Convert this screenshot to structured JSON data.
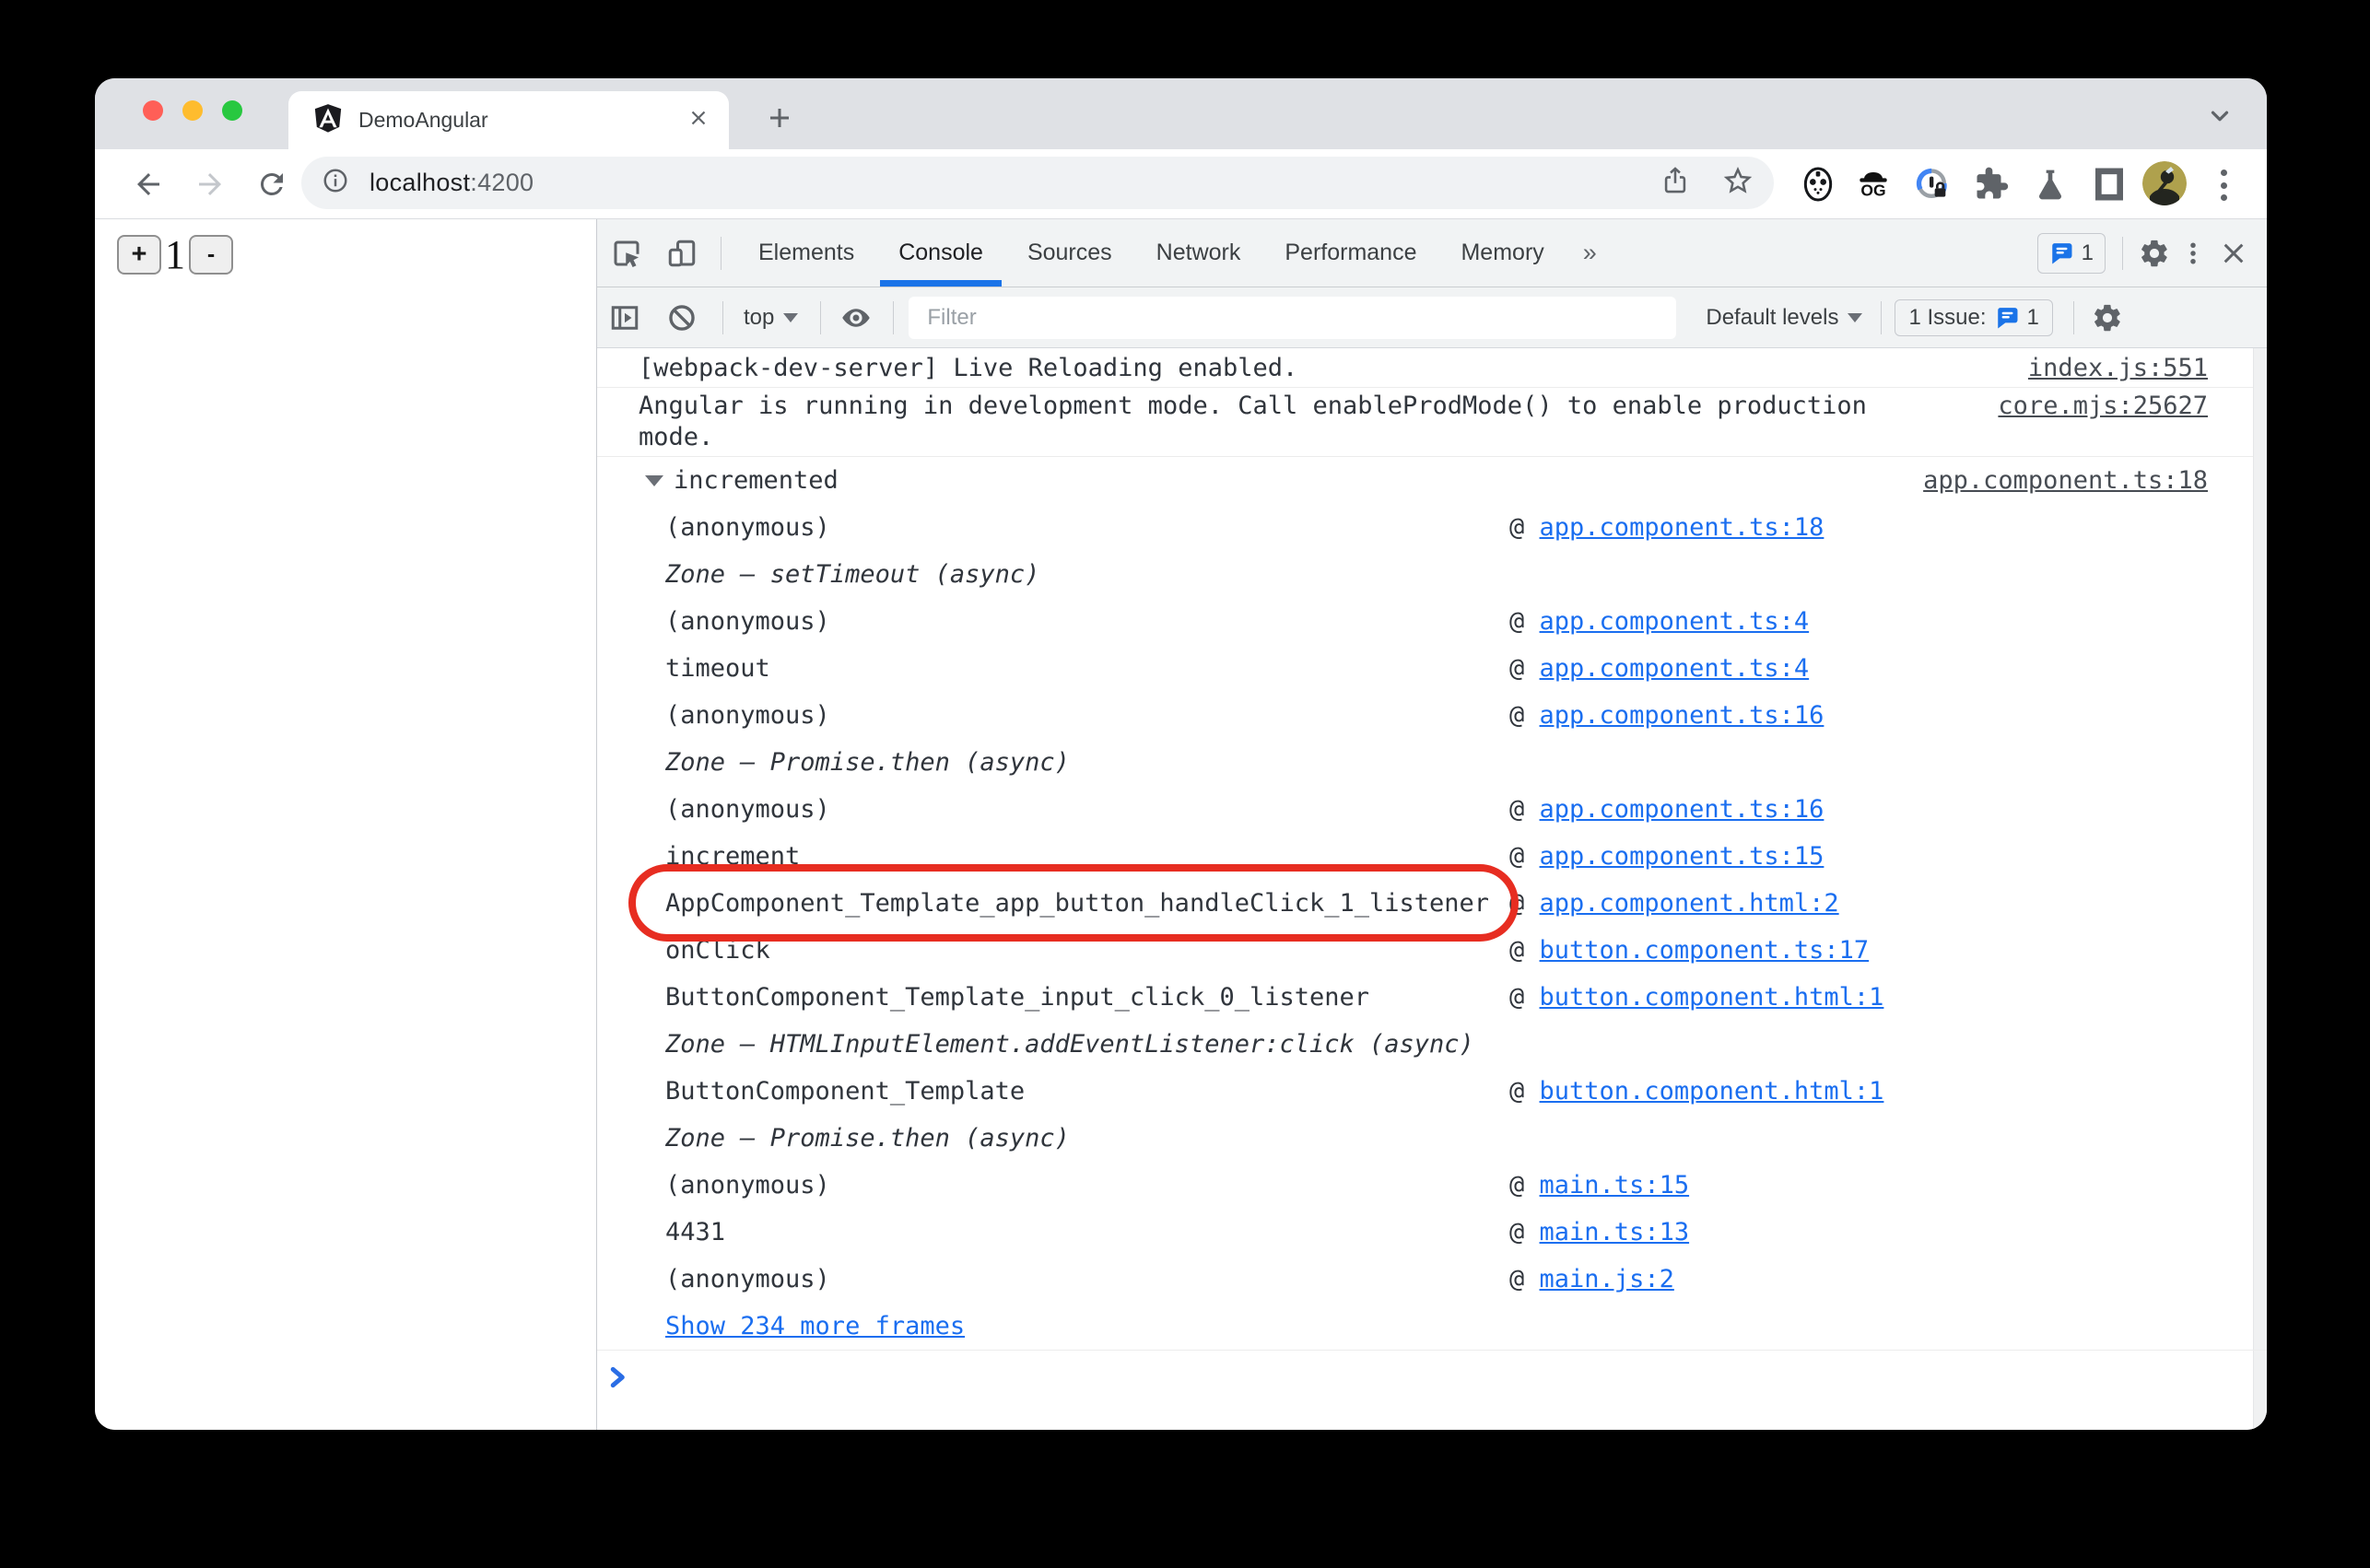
{
  "colors": {
    "accent_blue": "#1A73E8",
    "annotation_red": "#E72D21",
    "link_blue": "#1A6EF0"
  },
  "browser": {
    "tab_title": "DemoAngular",
    "url_host": "localhost",
    "url_port": ":4200"
  },
  "page": {
    "increment_label": "+",
    "counter_value": "1",
    "decrement_label": "-"
  },
  "devtools": {
    "tabs": {
      "elements": "Elements",
      "console": "Console",
      "sources": "Sources",
      "network": "Network",
      "performance": "Performance",
      "memory": "Memory",
      "more": "»"
    },
    "tabbar_issue_count": "1",
    "toolbar": {
      "context_selector": "top",
      "filter_placeholder": "Filter",
      "levels_label": "Default levels",
      "issues_label": "1 Issue:",
      "issues_count": "1"
    },
    "console": {
      "at_symbol": "@",
      "messages": [
        {
          "text": "[webpack-dev-server] Live Reloading enabled.",
          "source": "index.js:551"
        },
        {
          "text": "Angular is running in development mode. Call enableProdMode() to enable production mode.",
          "source": "core.mjs:25627"
        }
      ],
      "trace": {
        "title": "incremented",
        "source": "app.component.ts:18",
        "frames": [
          {
            "name": "(anonymous)",
            "at": "app.component.ts:18"
          },
          {
            "name": "Zone — setTimeout (async)",
            "at": ""
          },
          {
            "name": "(anonymous)",
            "at": "app.component.ts:4"
          },
          {
            "name": "timeout",
            "at": "app.component.ts:4"
          },
          {
            "name": "(anonymous)",
            "at": "app.component.ts:16"
          },
          {
            "name": "Zone — Promise.then (async)",
            "at": ""
          },
          {
            "name": "(anonymous)",
            "at": "app.component.ts:16"
          },
          {
            "name": "increment",
            "at": "app.component.ts:15"
          },
          {
            "name": "AppComponent_Template_app_button_handleClick_1_listener",
            "at": "app.component.html:2"
          },
          {
            "name": "onClick",
            "at": "button.component.ts:17"
          },
          {
            "name": "ButtonComponent_Template_input_click_0_listener",
            "at": "button.component.html:1"
          },
          {
            "name": "Zone — HTMLInputElement.addEventListener:click (async)",
            "at": ""
          },
          {
            "name": "ButtonComponent_Template",
            "at": "button.component.html:1"
          },
          {
            "name": "Zone — Promise.then (async)",
            "at": ""
          },
          {
            "name": "(anonymous)",
            "at": "main.ts:15"
          },
          {
            "name": "4431",
            "at": "main.ts:13"
          },
          {
            "name": "(anonymous)",
            "at": "main.js:2"
          }
        ],
        "show_more": "Show 234 more frames"
      }
    }
  }
}
